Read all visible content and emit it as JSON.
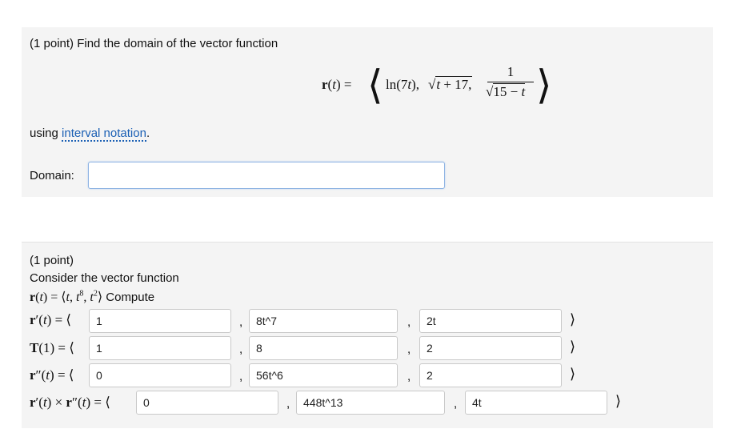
{
  "problem1": {
    "intro": "(1 point) Find the domain of the vector function",
    "function_lhs": "r(t) =",
    "comp1": "ln(7t),",
    "comp2_radicand": "t + 17,",
    "comp3_num": "1",
    "comp3_den": "15 − t",
    "using_text": "using",
    "interval_link": "interval notation",
    "period": ".",
    "domain_label": "Domain:",
    "domain_value": ""
  },
  "problem2": {
    "title": "(1 point)",
    "line1": "Consider the vector function",
    "function_text": "r(t) = ⟨t, t⁸, t²⟩",
    "compute_word": "Compute",
    "rows": [
      {
        "label": "r′(t) = ⟨",
        "values": [
          "1",
          "8t^7",
          "2t"
        ]
      },
      {
        "label": "T(1) = ⟨",
        "values": [
          "1",
          "8",
          "2"
        ]
      },
      {
        "label": "r″(t) = ⟨",
        "values": [
          "0",
          "56t^6",
          "2"
        ]
      },
      {
        "label": "r′(t) × r″(t) = ⟨",
        "values": [
          "0",
          "448t^13",
          "4t"
        ]
      }
    ],
    "comma": ",",
    "close": "⟩"
  }
}
